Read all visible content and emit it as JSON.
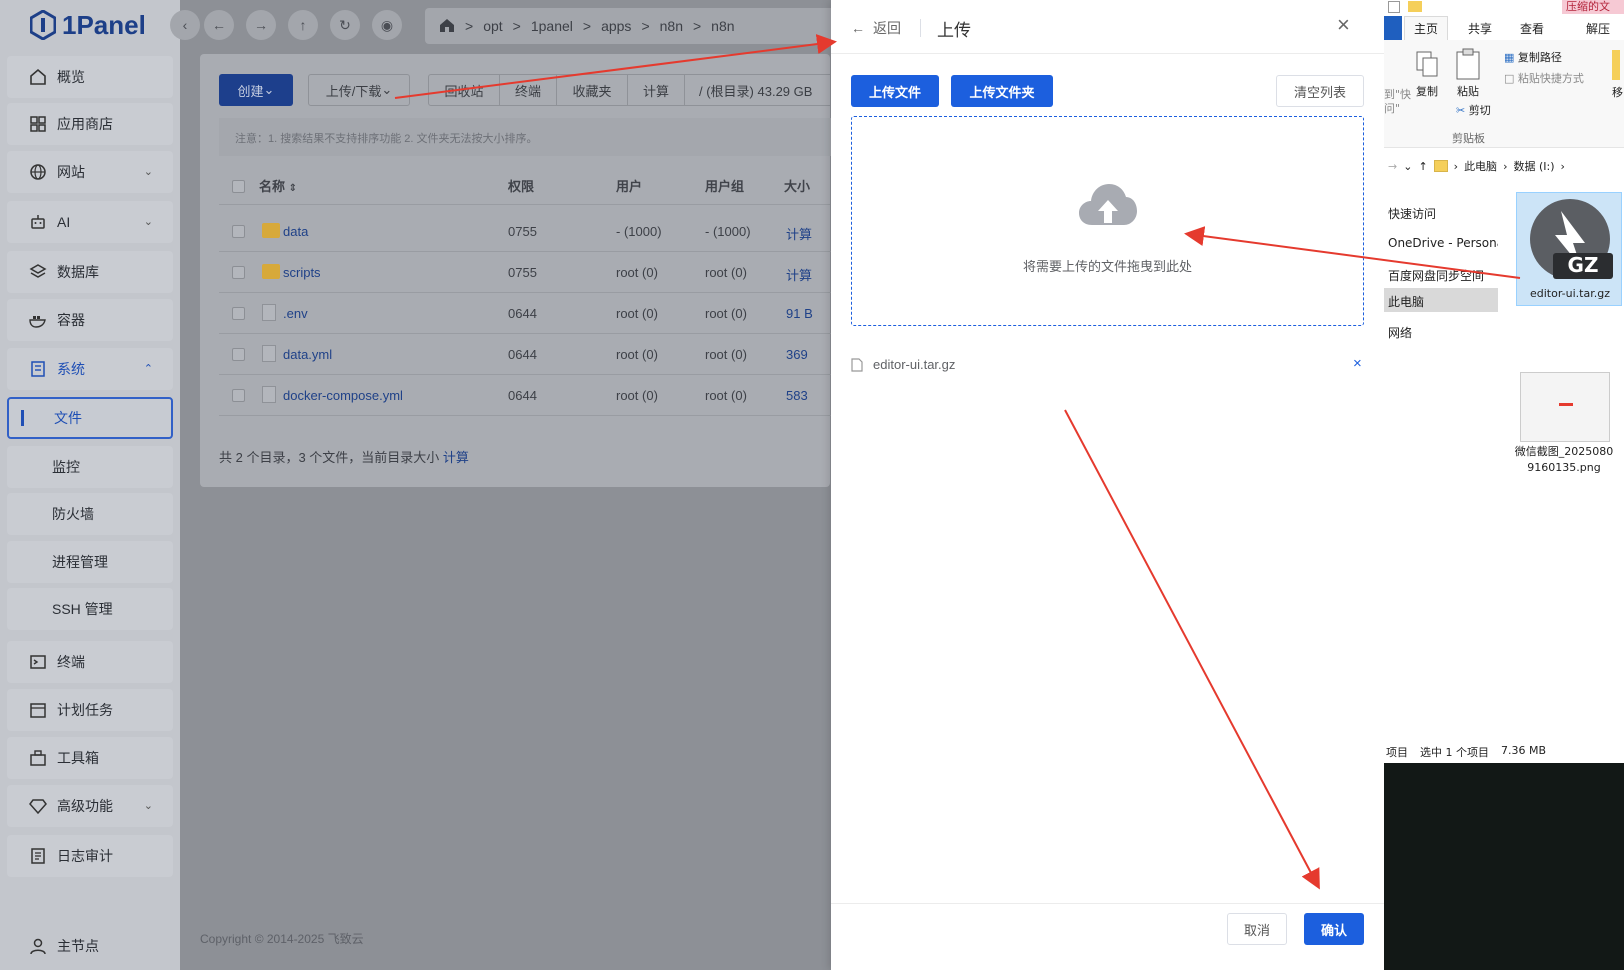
{
  "app": {
    "name": "1Panel"
  },
  "sidebar": {
    "items": [
      {
        "label": "概览",
        "icon": "home-icon"
      },
      {
        "label": "应用商店",
        "icon": "apps-icon"
      },
      {
        "label": "网站",
        "icon": "globe-icon"
      },
      {
        "label": "AI",
        "icon": "robot-icon"
      },
      {
        "label": "数据库",
        "icon": "database-icon"
      },
      {
        "label": "容器",
        "icon": "docker-icon"
      },
      {
        "label": "系统",
        "icon": "system-icon"
      },
      {
        "label": "文件"
      },
      {
        "label": "监控"
      },
      {
        "label": "防火墙"
      },
      {
        "label": "进程管理"
      },
      {
        "label": "SSH 管理"
      },
      {
        "label": "终端",
        "icon": "terminal-icon"
      },
      {
        "label": "计划任务",
        "icon": "calendar-icon"
      },
      {
        "label": "工具箱",
        "icon": "toolbox-icon"
      },
      {
        "label": "高级功能",
        "icon": "diamond-icon"
      },
      {
        "label": "日志审计",
        "icon": "log-icon"
      }
    ],
    "bottom": {
      "label": "主节点",
      "icon": "user-icon"
    }
  },
  "breadcrumb": [
    "opt",
    "1panel",
    "apps",
    "n8n",
    "n8n"
  ],
  "toolbar": {
    "create": "创建",
    "upload_download": "上传/下载",
    "recycle": "回收站",
    "terminal": "终端",
    "favorites": "收藏夹",
    "calc": "计算",
    "disk": "/ (根目录) 43.29 GB"
  },
  "notice": "注意：1. 搜索结果不支持排序功能 2. 文件夹无法按大小排序。",
  "table": {
    "headers": [
      "名称",
      "权限",
      "用户",
      "用户组",
      "大小"
    ],
    "rows": [
      {
        "name": "data",
        "perm": "0755",
        "user": "- (1000)",
        "group": "- (1000)",
        "size": "计算",
        "type": "folder"
      },
      {
        "name": "scripts",
        "perm": "0755",
        "user": "root (0)",
        "group": "root (0)",
        "size": "计算",
        "type": "folder"
      },
      {
        "name": ".env",
        "perm": "0644",
        "user": "root (0)",
        "group": "root (0)",
        "size": "91 B",
        "type": "file"
      },
      {
        "name": "data.yml",
        "perm": "0644",
        "user": "root (0)",
        "group": "root (0)",
        "size": "369",
        "type": "file"
      },
      {
        "name": "docker-compose.yml",
        "perm": "0644",
        "user": "root (0)",
        "group": "root (0)",
        "size": "583",
        "type": "file"
      }
    ],
    "summary": "共 2 个目录，3 个文件，当前目录大小",
    "summary_link": "计算"
  },
  "footer": "Copyright © 2014-2025 飞致云",
  "upload_drawer": {
    "back": "返回",
    "title": "上传",
    "upload_file": "上传文件",
    "upload_folder": "上传文件夹",
    "clear_list": "清空列表",
    "drop_hint": "将需要上传的文件拖曳到此处",
    "files": [
      "editor-ui.tar.gz"
    ],
    "cancel": "取消",
    "confirm": "确认"
  },
  "explorer": {
    "title_tab": "压缩的文",
    "tabs": [
      "主页",
      "共享",
      "查看",
      "解压"
    ],
    "ribbon": {
      "copy": "复制",
      "paste": "粘贴",
      "copy_path": "复制路径",
      "paste_shortcut": "粘贴快捷方式",
      "cut": "剪切",
      "clipboard": "剪贴板",
      "move": "移",
      "quick": "到\"快",
      "quick2": "问\""
    },
    "path": [
      "此电脑",
      "数据 (I:)"
    ],
    "nav": [
      "快速访问",
      "OneDrive - Persona",
      "百度网盘同步空间",
      "此电脑",
      "网络"
    ],
    "files": [
      {
        "name": "editor-ui.tar.gz",
        "badge": "GZ"
      },
      {
        "name": "微信截图_20250809160135.png"
      }
    ],
    "status": {
      "items": "项目",
      "selected": "选中 1 个项目",
      "size": "7.36 MB"
    }
  },
  "colors": {
    "primary": "#1c5fde",
    "arrow": "#e53a2e"
  }
}
